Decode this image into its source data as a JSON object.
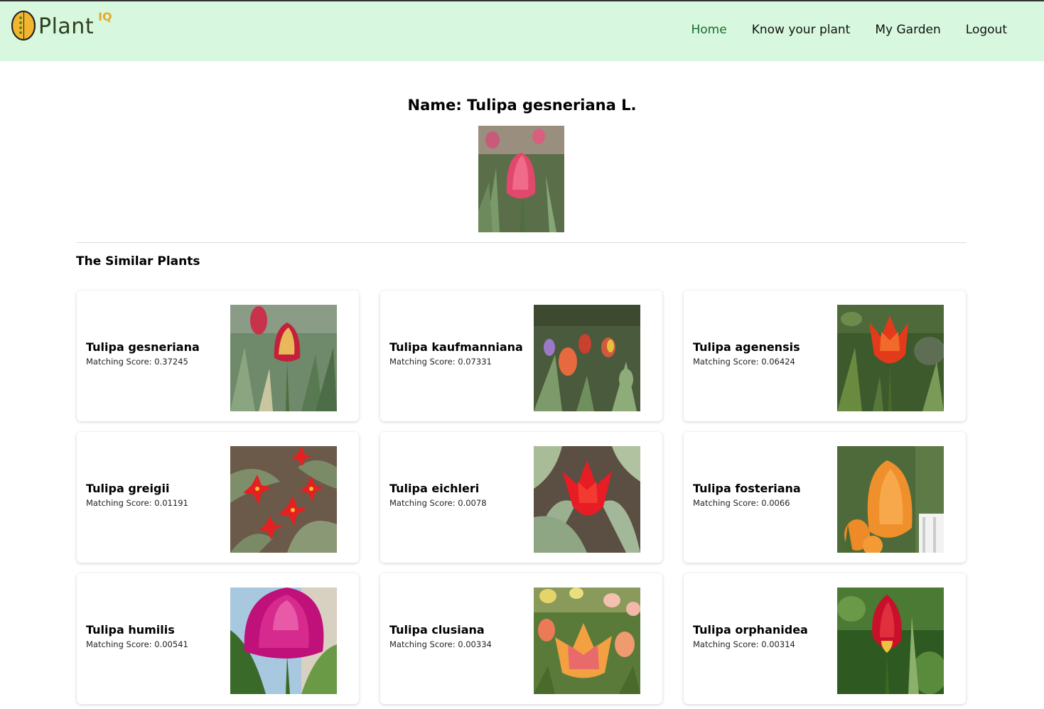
{
  "app": {
    "logo_text": "Plant",
    "logo_sup": "IQ"
  },
  "nav": {
    "items": [
      {
        "label": "Home",
        "active": true
      },
      {
        "label": "Know your plant",
        "active": false
      },
      {
        "label": "My Garden",
        "active": false
      },
      {
        "label": "Logout",
        "active": false
      }
    ]
  },
  "plant": {
    "name_prefix": "Name: ",
    "name": "Tulipa gesneriana L.",
    "title": "Name: Tulipa gesneriana L."
  },
  "similar": {
    "heading": "The Similar Plants",
    "score_label": "Matching Score:",
    "items": [
      {
        "name": "Tulipa gesneriana",
        "score": "Matching Score: 0.37245"
      },
      {
        "name": "Tulipa kaufmanniana",
        "score": "Matching Score: 0.07331"
      },
      {
        "name": "Tulipa agenensis",
        "score": "Matching Score: 0.06424"
      },
      {
        "name": "Tulipa greigii",
        "score": "Matching Score: 0.01191"
      },
      {
        "name": "Tulipa eichleri",
        "score": "Matching Score: 0.0078"
      },
      {
        "name": "Tulipa fosteriana",
        "score": "Matching Score: 0.0066"
      },
      {
        "name": "Tulipa humilis",
        "score": "Matching Score: 0.00541"
      },
      {
        "name": "Tulipa clusiana",
        "score": "Matching Score: 0.00334"
      },
      {
        "name": "Tulipa orphanidea",
        "score": "Matching Score: 0.00314"
      }
    ]
  },
  "colors": {
    "navbar_bg": "#d7f8de",
    "nav_active": "#1a6b2c",
    "logo_accent": "#e3ab2a"
  }
}
